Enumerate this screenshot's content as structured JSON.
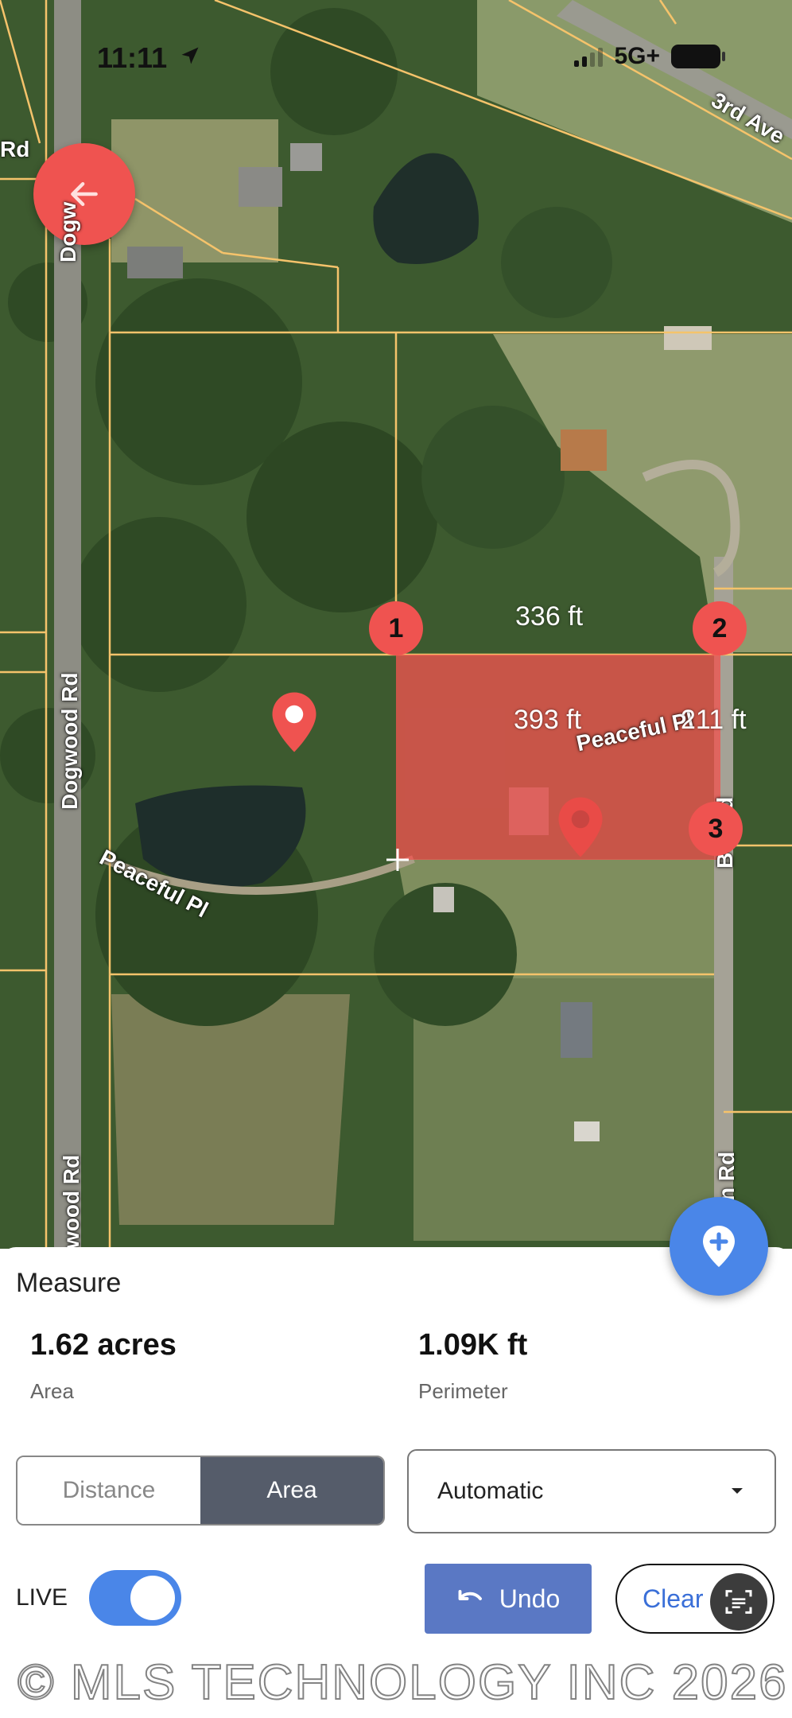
{
  "status_bar": {
    "time": "11:11",
    "network": "5G+"
  },
  "map": {
    "roads": {
      "top_left": "Rd",
      "dogwood_upper": "Dogw",
      "third_ave": "3rd Ave",
      "dogwood_mid": "Dogwood Rd",
      "peaceful_left": "Peaceful Pl",
      "peaceful_right": "Peaceful Pl",
      "right_road_mid": "B  d Rd",
      "dogwood_lower": "wood Rd",
      "right_road_lower": "n Rd"
    },
    "measurements": {
      "top_edge": "336 ft",
      "diagonal": "393 ft",
      "right_edge": "211 ft"
    },
    "vertices": [
      "1",
      "2",
      "3"
    ],
    "polygon_color": "#ef5350"
  },
  "panel": {
    "title": "Measure",
    "area_value": "1.62 acres",
    "area_label": "Area",
    "perimeter_value": "1.09K ft",
    "perimeter_label": "Perimeter",
    "mode_tabs": [
      {
        "label": "Distance",
        "selected": false
      },
      {
        "label": "Area",
        "selected": true
      }
    ],
    "units_select": "Automatic",
    "live_label": "LIVE",
    "live_on": true,
    "undo_label": "Undo",
    "clear_label": "Clear"
  },
  "icons": {
    "back": "arrow-left-icon",
    "add_pin": "add-location-icon",
    "dropdown": "caret-down-icon",
    "undo": "undo-arrow-icon",
    "scan": "scan-text-icon"
  },
  "colors": {
    "accent_blue": "#4a86e8",
    "accent_red": "#ef5350",
    "segment_active": "#555c6a",
    "undo_button": "#5a78c4",
    "parcel_line": "#f5c36b"
  },
  "watermark": "© MLS TECHNOLOGY INC 2026"
}
